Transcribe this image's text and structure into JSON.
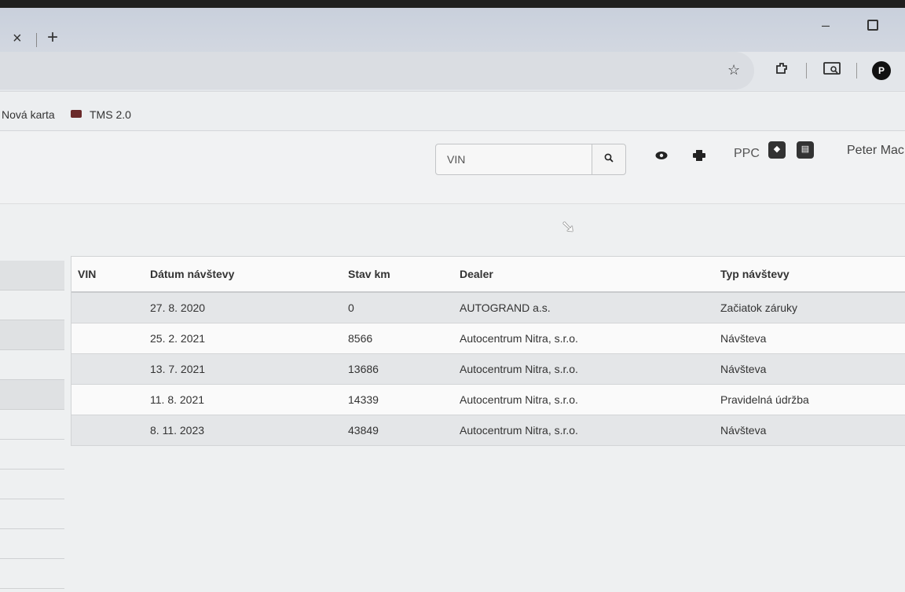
{
  "browser": {
    "tab_close": "×",
    "tab_new": "+",
    "minimize": "–",
    "profile_initial": "P",
    "bookmarks": [
      {
        "label": "Nová karta"
      },
      {
        "label": "TMS 2.0"
      }
    ]
  },
  "header": {
    "search": {
      "placeholder": "VIN",
      "value": ""
    },
    "ppc_label": "PPC",
    "user_name": "Peter Mac"
  },
  "table": {
    "columns": [
      "VIN",
      "Dátum návštevy",
      "Stav km",
      "Dealer",
      "Typ návštevy"
    ],
    "rows": [
      {
        "vin": "",
        "date": "27. 8. 2020",
        "km": "0",
        "dealer": "AUTOGRAND a.s.",
        "type": "Začiatok záruky"
      },
      {
        "vin": "",
        "date": "25. 2. 2021",
        "km": "8566",
        "dealer": "Autocentrum Nitra, s.r.o.",
        "type": "Návšteva"
      },
      {
        "vin": "",
        "date": "13. 7. 2021",
        "km": "13686",
        "dealer": "Autocentrum Nitra, s.r.o.",
        "type": "Návšteva"
      },
      {
        "vin": "",
        "date": "11. 8. 2021",
        "km": "14339",
        "dealer": "Autocentrum Nitra, s.r.o.",
        "type": "Pravidelná údržba"
      },
      {
        "vin": "",
        "date": "8. 11. 2023",
        "km": "43849",
        "dealer": "Autocentrum Nitra, s.r.o.",
        "type": "Návšteva"
      }
    ]
  }
}
